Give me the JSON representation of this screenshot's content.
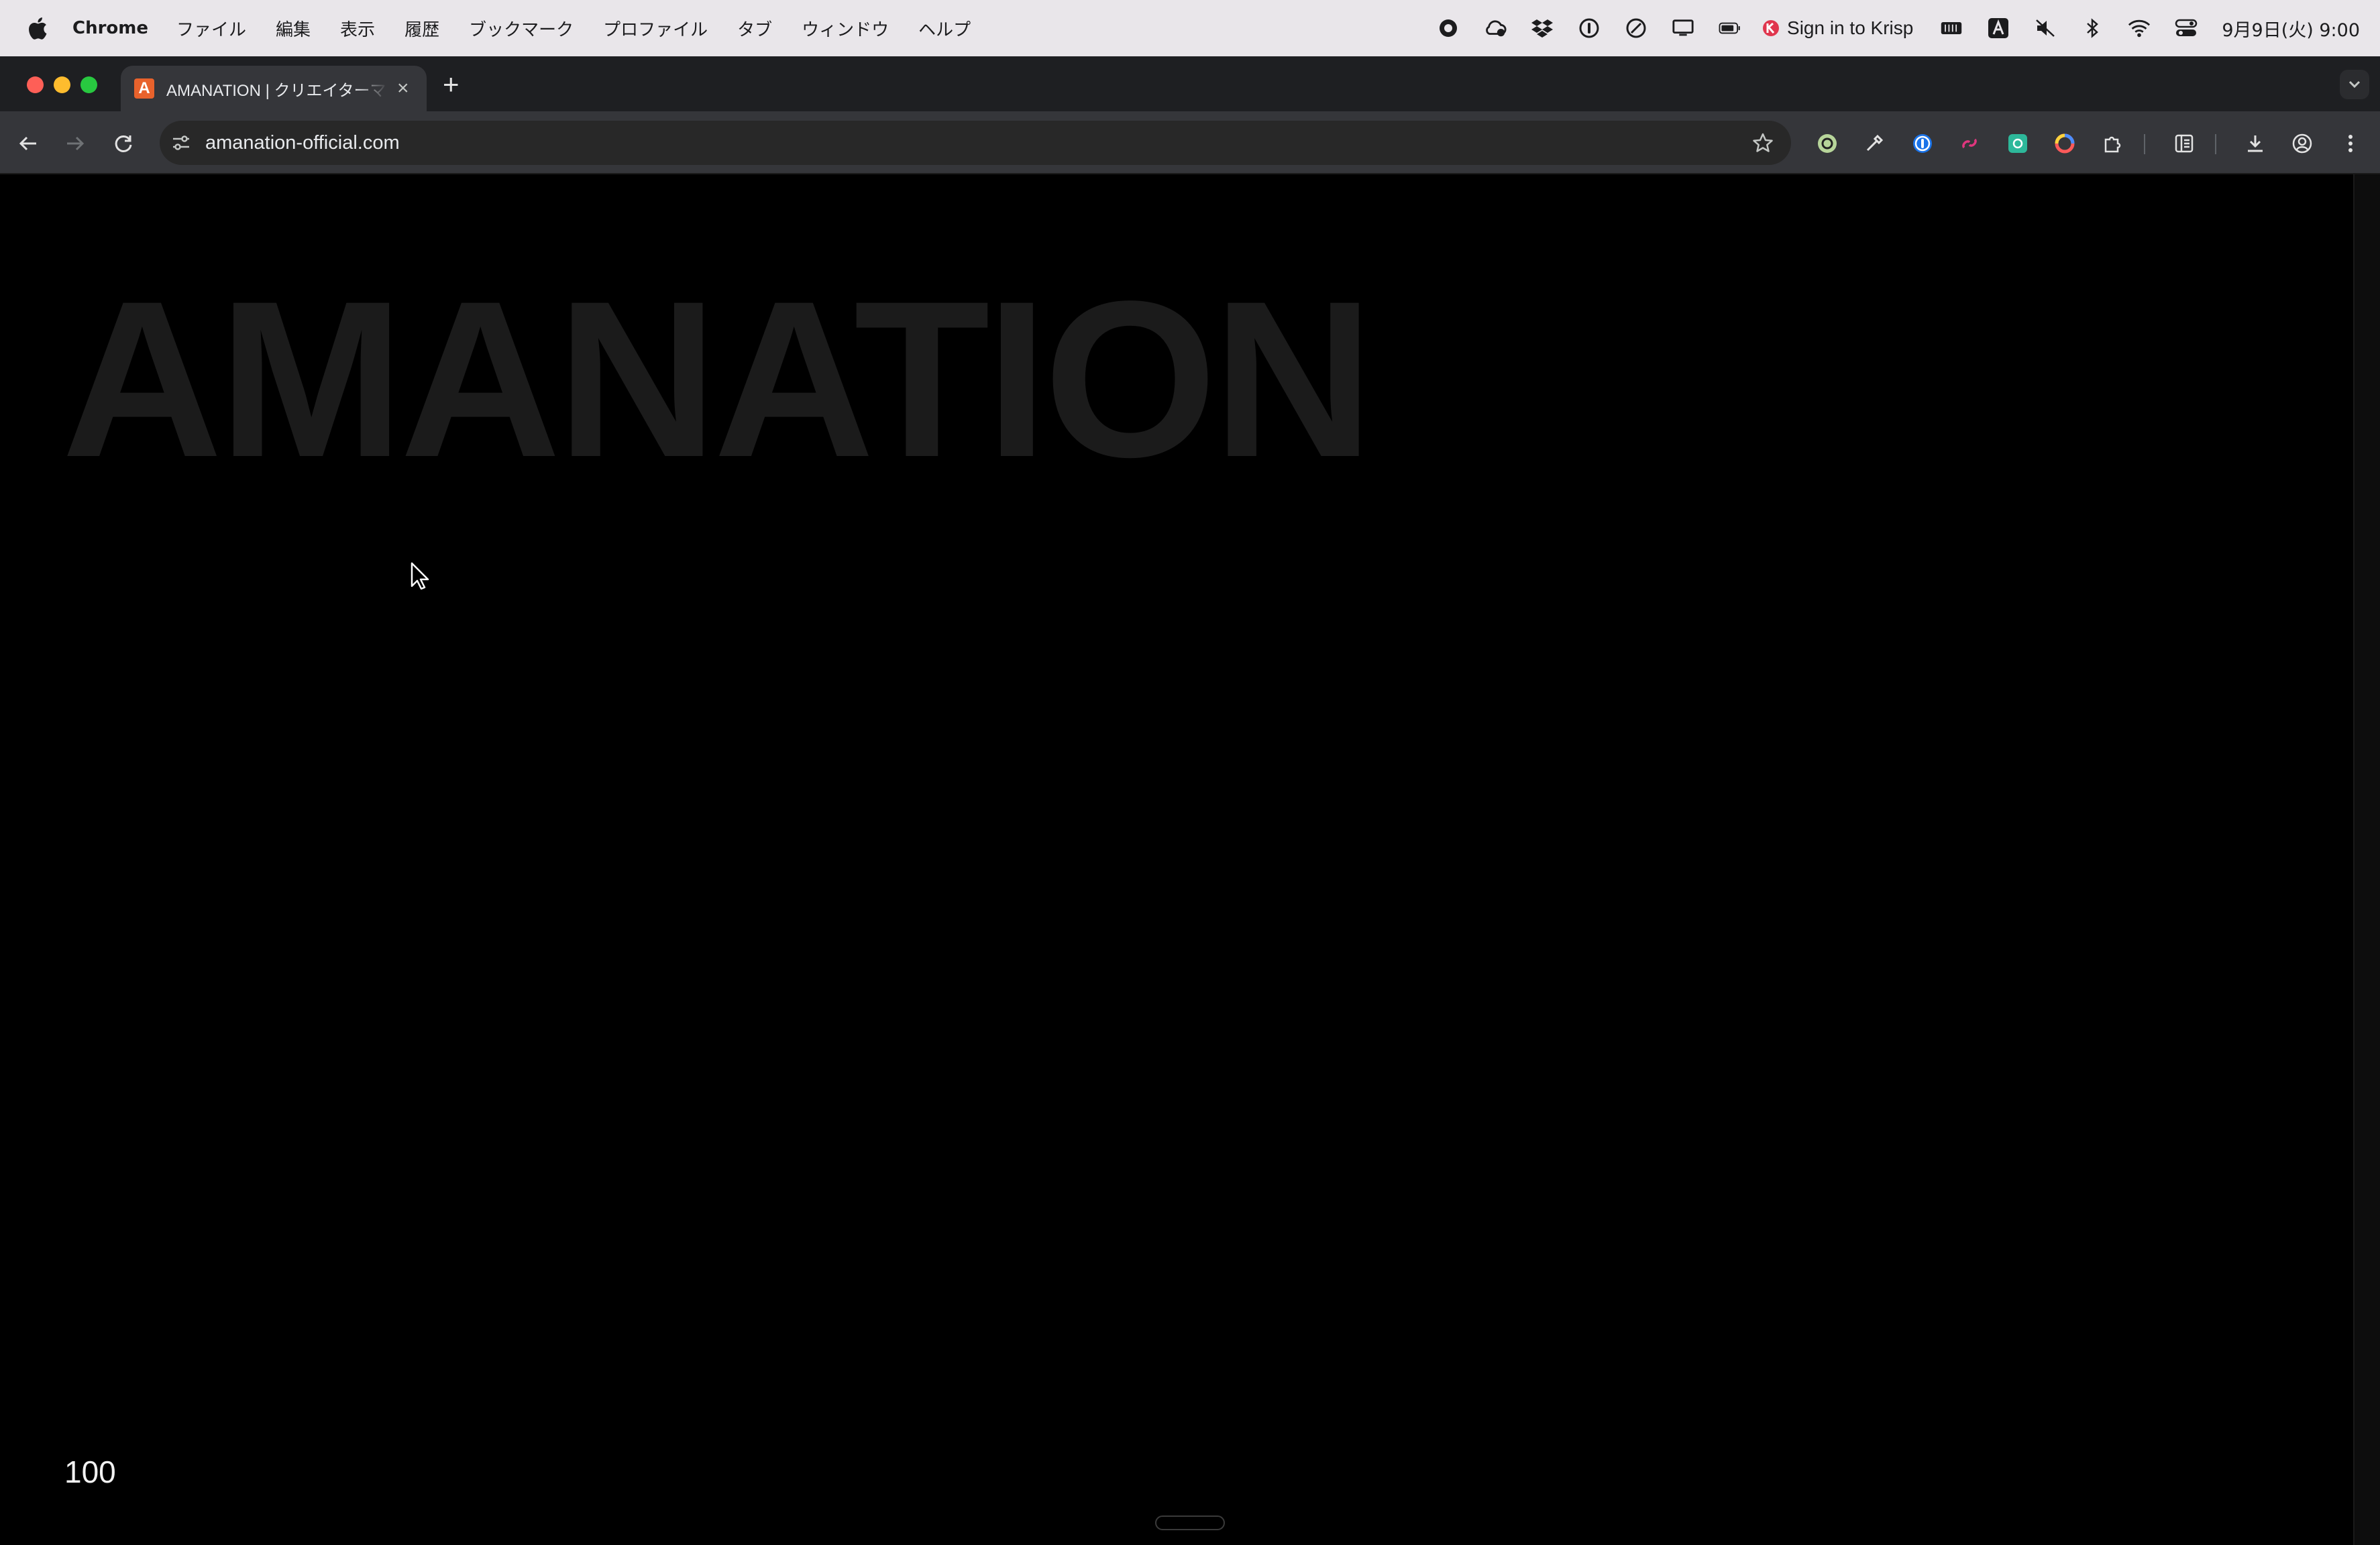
{
  "menubar": {
    "app_name": "Chrome",
    "items": [
      "ファイル",
      "編集",
      "表示",
      "履歴",
      "ブックマーク",
      "プロファイル",
      "タブ",
      "ウィンドウ",
      "ヘルプ"
    ],
    "krisp_label": "Sign in to Krisp",
    "clock": "9月9日(火) 9:00"
  },
  "tab": {
    "title": "AMANATION | クリエイターマネジメント",
    "favicon_letter": "A"
  },
  "omnibox": {
    "url": "amanation-official.com"
  },
  "page": {
    "hero_title": "AMANATION",
    "loader_count": "100"
  },
  "colors": {
    "page_background": "#000000",
    "hero_text": "#1b1b1b",
    "favicon": "#e8622c"
  }
}
